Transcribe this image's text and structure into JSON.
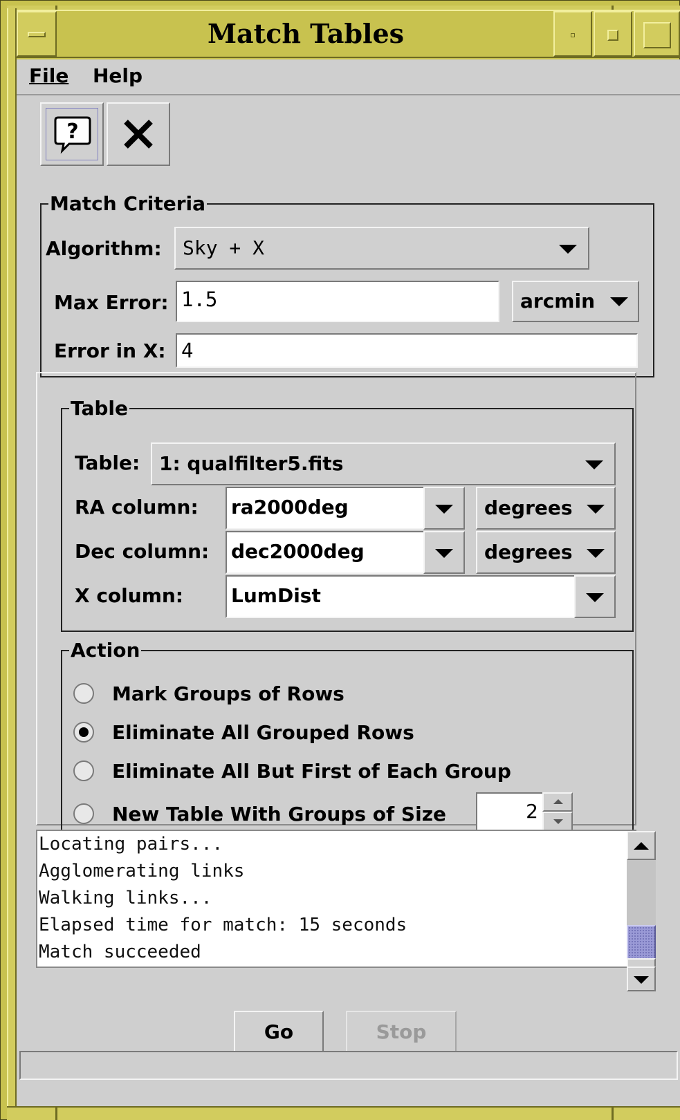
{
  "window": {
    "title": "Match Tables"
  },
  "menu": {
    "file": "File",
    "help": "Help"
  },
  "toolbar": {
    "help_icon": "help-speech-bubble-icon",
    "close_icon": "close-x-icon"
  },
  "match_criteria": {
    "legend": "Match Criteria",
    "algorithm_label": "Algorithm:",
    "algorithm_value": "Sky + X",
    "max_error_label": "Max Error:",
    "max_error_value": "1.5",
    "max_error_unit": "arcmin",
    "error_x_label": "Error in X:",
    "error_x_value": "4"
  },
  "table": {
    "legend": "Table",
    "table_label": "Table:",
    "table_value": "1: qualfilter5.fits",
    "ra_label": "RA column:",
    "ra_value": "ra2000deg",
    "ra_unit": "degrees",
    "dec_label": "Dec column:",
    "dec_value": "dec2000deg",
    "dec_unit": "degrees",
    "x_label": "X column:",
    "x_value": "LumDist"
  },
  "action": {
    "legend": "Action",
    "options": [
      {
        "label": "Mark Groups of Rows",
        "selected": false
      },
      {
        "label": "Eliminate All Grouped Rows",
        "selected": true
      },
      {
        "label": "Eliminate All But First of Each Group",
        "selected": false
      },
      {
        "label": "New Table With Groups of Size",
        "selected": false
      }
    ],
    "group_size": "2"
  },
  "log": {
    "lines": [
      "Locating pairs...",
      "Agglomerating links",
      "Walking links...",
      "Elapsed time for match: 15 seconds",
      "Match succeeded"
    ]
  },
  "buttons": {
    "go": "Go",
    "stop": "Stop"
  },
  "colors": {
    "frame": "#c8c24f",
    "panel": "#cfcfcf",
    "scroll_thumb": "#9a9ad6"
  }
}
